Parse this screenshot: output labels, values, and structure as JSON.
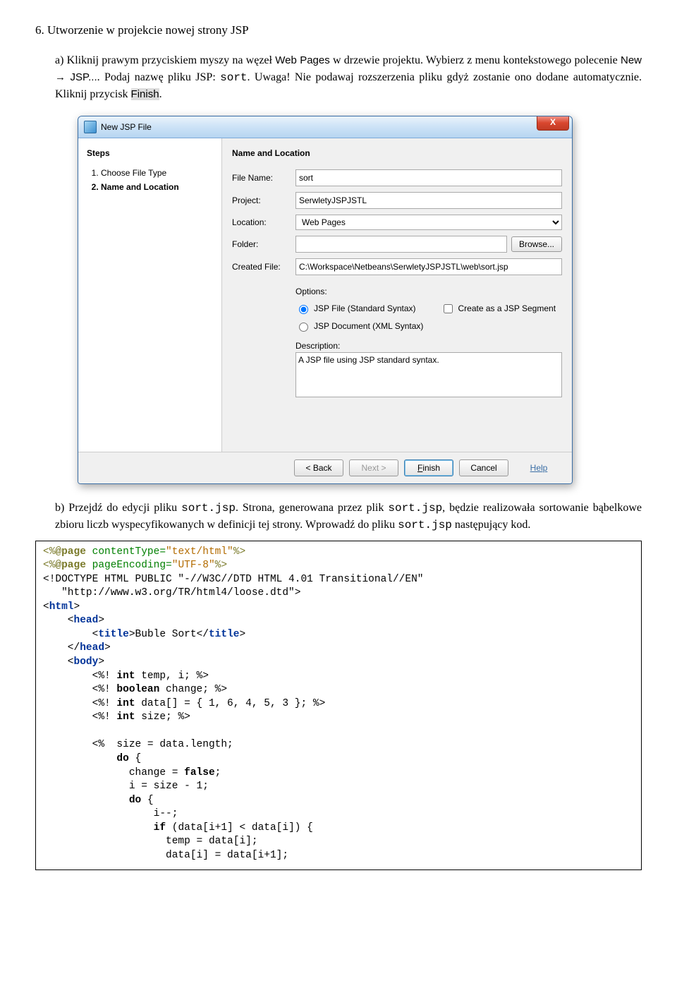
{
  "heading": "6. Utworzenie w projekcie nowej strony JSP",
  "item_a_parts": {
    "letter": "a)",
    "pre1": "Kliknij prawym przyciskiem myszy na węzeł ",
    "webpages": "Web Pages",
    "post1": " w drzewie projektu. Wybierz z menu kontekstowego polecenie ",
    "newjsp": "New → JSP...",
    "post2": ". Podaj nazwę pliku JSP: ",
    "sort": "sort",
    "post3": ". Uwaga! Nie podawaj rozszerzenia pliku gdyż zostanie ono dodane automatycznie. Kliknij przycisk ",
    "finish": "Finish",
    "dot": "."
  },
  "dialog": {
    "title": "New JSP File",
    "steps_heading": "Steps",
    "steps": [
      "Choose File Type",
      "Name and Location"
    ],
    "main_heading": "Name and Location",
    "labels": {
      "file_name": "File Name:",
      "project": "Project:",
      "location": "Location:",
      "folder": "Folder:",
      "created": "Created File:",
      "options": "Options:",
      "description": "Description:"
    },
    "values": {
      "file_name": "sort",
      "project": "SerwletyJSPJSTL",
      "location": "Web Pages",
      "folder": "",
      "created": "C:\\Workspace\\Netbeans\\SerwletyJSPJSTL\\web\\sort.jsp",
      "opt1": "JSP File (Standard Syntax)",
      "opt2": "JSP Document (XML Syntax)",
      "chk1": "Create as a JSP Segment",
      "desc": "A JSP file using JSP standard syntax."
    },
    "buttons": {
      "browse": "Browse...",
      "back": "< Back",
      "next": "Next >",
      "finish": "Finish",
      "cancel": "Cancel",
      "help": "Help"
    }
  },
  "item_b_parts": {
    "letter": "b)",
    "pre1": "Przejdź do edycji pliku ",
    "sortjsp": "sort.jsp",
    "post1": ". Strona, generowana przez plik ",
    "sortjsp2": "sort.jsp",
    "post2": ", będzie realizowała sortowanie bąbelkowe zbioru liczb wyspecyfikowanych w definicji tej strony. Wprowadź do pliku ",
    "sortjsp3": "sort.jsp",
    "post3": " następujący kod."
  },
  "code": {
    "l01a": "<%",
    "l01b": "@page",
    "l01c": " contentType=",
    "l01d": "\"text/html\"",
    "l01e": "%>",
    "l02a": "<%",
    "l02b": "@page",
    "l02c": " pageEncoding=",
    "l02d": "\"UTF-8\"",
    "l02e": "%>",
    "l03": "<!DOCTYPE HTML PUBLIC \"-//W3C//DTD HTML 4.01 Transitional//EN\"",
    "l04": "   \"http://www.w3.org/TR/html4/loose.dtd\">",
    "l05a": "<",
    "l05b": "html",
    "l05c": ">",
    "l06a": "    <",
    "l06b": "head",
    "l06c": ">",
    "l07a": "        <",
    "l07b": "title",
    "l07c": ">",
    "l07d": "Buble Sort",
    "l07e": "</",
    "l07f": "title",
    "l07g": ">",
    "l08a": "    </",
    "l08b": "head",
    "l08c": ">",
    "l09a": "    <",
    "l09b": "body",
    "l09c": ">",
    "l10a": "        <%! ",
    "l10b": "int",
    "l10c": " temp, i; %>",
    "l11a": "        <%! ",
    "l11b": "boolean",
    "l11c": " change; %>",
    "l12a": "        <%! ",
    "l12b": "int",
    "l12c": " data[] = { 1, 6, 4, 5, 3 }; %>",
    "l13a": "        <%! ",
    "l13b": "int",
    "l13c": " size; %>",
    "l14": "",
    "l15": "        <%  size = data.length;",
    "l16a": "            ",
    "l16b": "do",
    "l16c": " {",
    "l17a": "              change = ",
    "l17b": "false",
    "l17c": ";",
    "l18": "              i = size - 1;",
    "l19a": "              ",
    "l19b": "do",
    "l19c": " {",
    "l20": "                  i--;",
    "l21a": "                  ",
    "l21b": "if",
    "l21c": " (data[i+1] < data[i]) {",
    "l22": "                    temp = data[i];",
    "l23": "                    data[i] = data[i+1];"
  }
}
